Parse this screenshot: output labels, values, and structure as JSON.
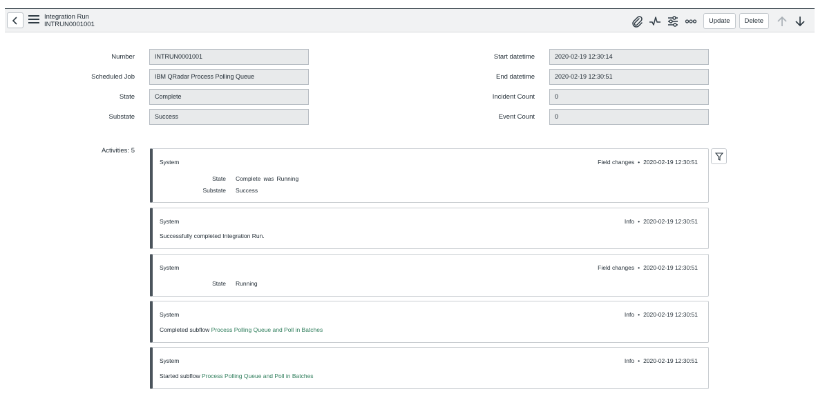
{
  "header": {
    "title": "Integration Run",
    "record_number": "INTRUN0001001",
    "buttons": {
      "update": "Update",
      "delete": "Delete"
    },
    "icons": [
      "chevron-left-icon",
      "hamburger-menu-icon",
      "paperclip-icon",
      "activity-pulse-icon",
      "sliders-icon",
      "more-icon",
      "arrow-up-icon",
      "arrow-down-icon"
    ]
  },
  "form": {
    "left": [
      {
        "label": "Number",
        "value": "INTRUN0001001"
      },
      {
        "label": "Scheduled Job",
        "value": "IBM QRadar Process Polling Queue"
      },
      {
        "label": "State",
        "value": "Complete"
      },
      {
        "label": "Substate",
        "value": "Success"
      }
    ],
    "right": [
      {
        "label": "Start datetime",
        "value": "2020-02-19 12:30:14"
      },
      {
        "label": "End datetime",
        "value": "2020-02-19 12:30:51"
      },
      {
        "label": "Incident Count",
        "value": "0"
      },
      {
        "label": "Event Count",
        "value": "0"
      }
    ]
  },
  "activities": {
    "label": "Activities: 5",
    "items": [
      {
        "author": "System",
        "type": "Field changes",
        "time": "2020-02-19 12:30:51",
        "changes": [
          {
            "label": "State",
            "new": "Complete",
            "was_word": "was",
            "old": "Running"
          },
          {
            "label": "Substate",
            "new": "Success"
          }
        ]
      },
      {
        "author": "System",
        "type": "Info",
        "time": "2020-02-19 12:30:51",
        "text": "Successfully completed Integration Run."
      },
      {
        "author": "System",
        "type": "Field changes",
        "time": "2020-02-19 12:30:51",
        "changes": [
          {
            "label": "State",
            "new": "Running"
          }
        ]
      },
      {
        "author": "System",
        "type": "Info",
        "time": "2020-02-19 12:30:51",
        "text_prefix": "Completed subflow ",
        "link": "Process Polling Queue and Poll in Batches"
      },
      {
        "author": "System",
        "type": "Info",
        "time": "2020-02-19 12:30:51",
        "text_prefix": "Started subflow ",
        "link": "Process Polling Queue and Poll in Batches"
      }
    ],
    "separator": "•"
  },
  "colors": {
    "header_bg": "#f1f2f3",
    "field_bg": "#e8eaeb",
    "link": "#2e7d5b",
    "card_accent": "#4b545c"
  }
}
